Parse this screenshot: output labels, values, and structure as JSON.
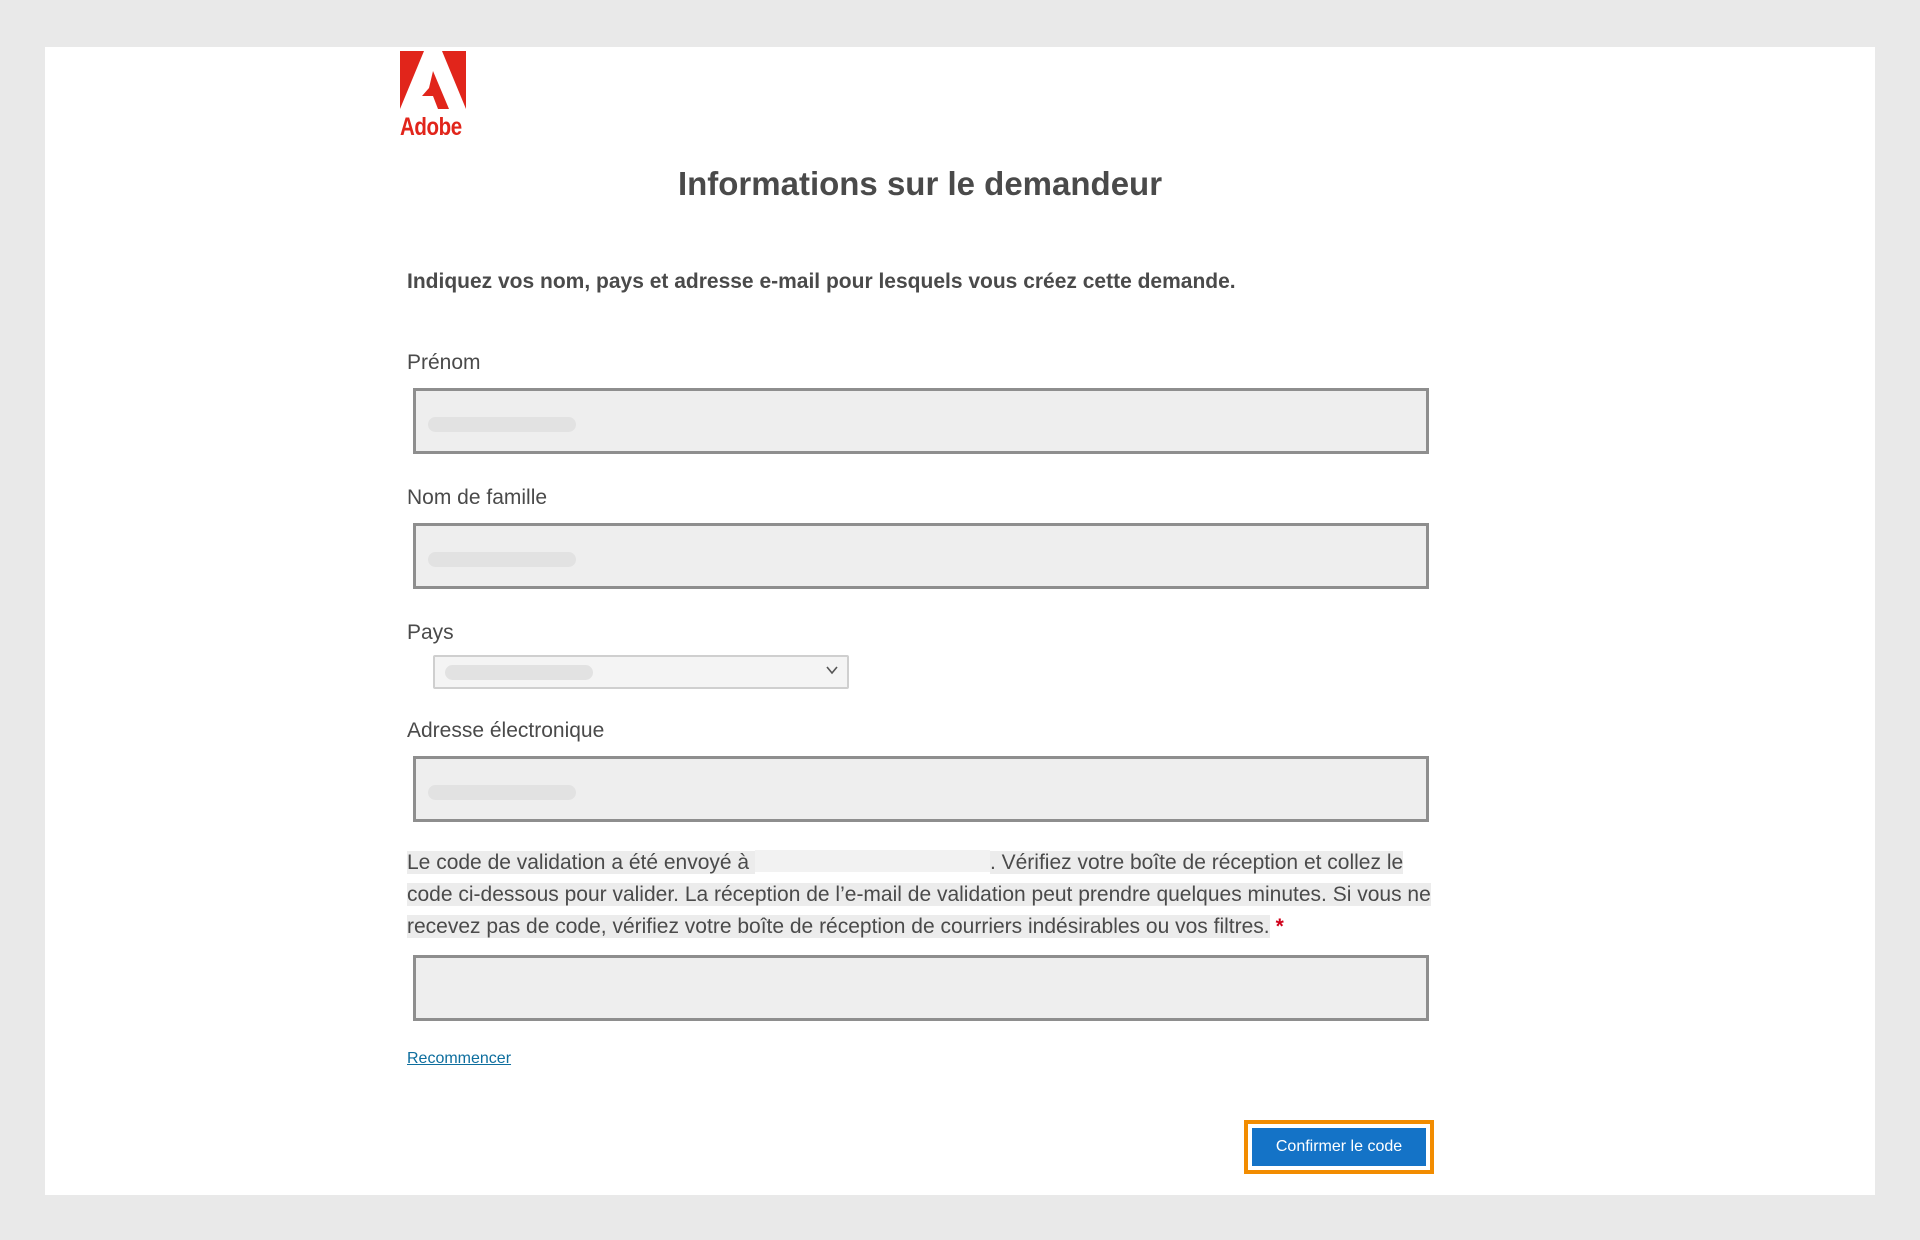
{
  "brand": {
    "logo_text": "Adobe",
    "color": "#e1251b"
  },
  "page": {
    "title": "Informations sur le demandeur",
    "subtitle": "Indiquez vos nom, pays et adresse e-mail pour lesquels vous créez cette demande."
  },
  "form": {
    "first_name": {
      "label": "Prénom",
      "value": ""
    },
    "last_name": {
      "label": "Nom de famille",
      "value": ""
    },
    "country": {
      "label": "Pays",
      "value": ""
    },
    "email": {
      "label": "Adresse électronique",
      "value": ""
    },
    "validation": {
      "text_before": "Le code de validation a été envoyé à ",
      "text_after": ". Vérifiez votre boîte de réception et collez le code ci-dessous pour valider. La réception de l’e-mail de validation peut prendre quelques minutes. Si vous ne recevez pas de code, vérifiez votre boîte de réception de courriers indésirables ou vos filtres.",
      "required_marker": "*",
      "code_value": ""
    },
    "restart_link": "Recommencer",
    "confirm_button": "Confirmer le code"
  },
  "colors": {
    "accent_button": "#1473c7",
    "focus_outline": "#f28c00",
    "link": "#0e6e9e",
    "required": "#d0021b"
  }
}
